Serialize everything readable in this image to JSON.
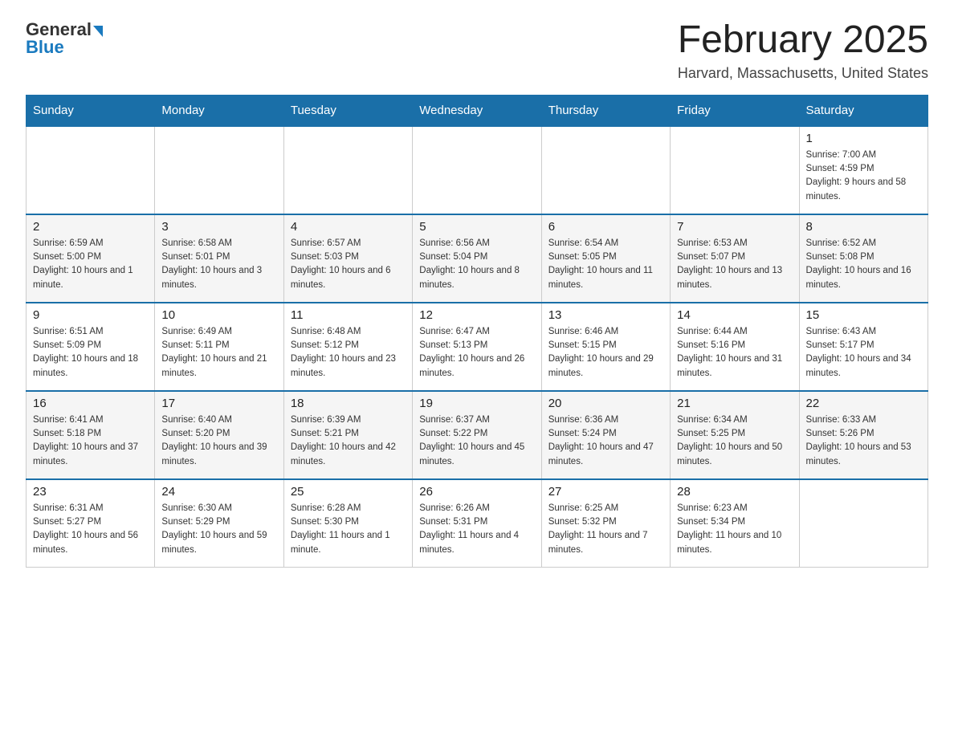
{
  "header": {
    "logo_general": "General",
    "logo_blue": "Blue",
    "month_title": "February 2025",
    "location": "Harvard, Massachusetts, United States"
  },
  "days_of_week": [
    "Sunday",
    "Monday",
    "Tuesday",
    "Wednesday",
    "Thursday",
    "Friday",
    "Saturday"
  ],
  "weeks": [
    [
      {
        "day": "",
        "info": ""
      },
      {
        "day": "",
        "info": ""
      },
      {
        "day": "",
        "info": ""
      },
      {
        "day": "",
        "info": ""
      },
      {
        "day": "",
        "info": ""
      },
      {
        "day": "",
        "info": ""
      },
      {
        "day": "1",
        "info": "Sunrise: 7:00 AM\nSunset: 4:59 PM\nDaylight: 9 hours and 58 minutes."
      }
    ],
    [
      {
        "day": "2",
        "info": "Sunrise: 6:59 AM\nSunset: 5:00 PM\nDaylight: 10 hours and 1 minute."
      },
      {
        "day": "3",
        "info": "Sunrise: 6:58 AM\nSunset: 5:01 PM\nDaylight: 10 hours and 3 minutes."
      },
      {
        "day": "4",
        "info": "Sunrise: 6:57 AM\nSunset: 5:03 PM\nDaylight: 10 hours and 6 minutes."
      },
      {
        "day": "5",
        "info": "Sunrise: 6:56 AM\nSunset: 5:04 PM\nDaylight: 10 hours and 8 minutes."
      },
      {
        "day": "6",
        "info": "Sunrise: 6:54 AM\nSunset: 5:05 PM\nDaylight: 10 hours and 11 minutes."
      },
      {
        "day": "7",
        "info": "Sunrise: 6:53 AM\nSunset: 5:07 PM\nDaylight: 10 hours and 13 minutes."
      },
      {
        "day": "8",
        "info": "Sunrise: 6:52 AM\nSunset: 5:08 PM\nDaylight: 10 hours and 16 minutes."
      }
    ],
    [
      {
        "day": "9",
        "info": "Sunrise: 6:51 AM\nSunset: 5:09 PM\nDaylight: 10 hours and 18 minutes."
      },
      {
        "day": "10",
        "info": "Sunrise: 6:49 AM\nSunset: 5:11 PM\nDaylight: 10 hours and 21 minutes."
      },
      {
        "day": "11",
        "info": "Sunrise: 6:48 AM\nSunset: 5:12 PM\nDaylight: 10 hours and 23 minutes."
      },
      {
        "day": "12",
        "info": "Sunrise: 6:47 AM\nSunset: 5:13 PM\nDaylight: 10 hours and 26 minutes."
      },
      {
        "day": "13",
        "info": "Sunrise: 6:46 AM\nSunset: 5:15 PM\nDaylight: 10 hours and 29 minutes."
      },
      {
        "day": "14",
        "info": "Sunrise: 6:44 AM\nSunset: 5:16 PM\nDaylight: 10 hours and 31 minutes."
      },
      {
        "day": "15",
        "info": "Sunrise: 6:43 AM\nSunset: 5:17 PM\nDaylight: 10 hours and 34 minutes."
      }
    ],
    [
      {
        "day": "16",
        "info": "Sunrise: 6:41 AM\nSunset: 5:18 PM\nDaylight: 10 hours and 37 minutes."
      },
      {
        "day": "17",
        "info": "Sunrise: 6:40 AM\nSunset: 5:20 PM\nDaylight: 10 hours and 39 minutes."
      },
      {
        "day": "18",
        "info": "Sunrise: 6:39 AM\nSunset: 5:21 PM\nDaylight: 10 hours and 42 minutes."
      },
      {
        "day": "19",
        "info": "Sunrise: 6:37 AM\nSunset: 5:22 PM\nDaylight: 10 hours and 45 minutes."
      },
      {
        "day": "20",
        "info": "Sunrise: 6:36 AM\nSunset: 5:24 PM\nDaylight: 10 hours and 47 minutes."
      },
      {
        "day": "21",
        "info": "Sunrise: 6:34 AM\nSunset: 5:25 PM\nDaylight: 10 hours and 50 minutes."
      },
      {
        "day": "22",
        "info": "Sunrise: 6:33 AM\nSunset: 5:26 PM\nDaylight: 10 hours and 53 minutes."
      }
    ],
    [
      {
        "day": "23",
        "info": "Sunrise: 6:31 AM\nSunset: 5:27 PM\nDaylight: 10 hours and 56 minutes."
      },
      {
        "day": "24",
        "info": "Sunrise: 6:30 AM\nSunset: 5:29 PM\nDaylight: 10 hours and 59 minutes."
      },
      {
        "day": "25",
        "info": "Sunrise: 6:28 AM\nSunset: 5:30 PM\nDaylight: 11 hours and 1 minute."
      },
      {
        "day": "26",
        "info": "Sunrise: 6:26 AM\nSunset: 5:31 PM\nDaylight: 11 hours and 4 minutes."
      },
      {
        "day": "27",
        "info": "Sunrise: 6:25 AM\nSunset: 5:32 PM\nDaylight: 11 hours and 7 minutes."
      },
      {
        "day": "28",
        "info": "Sunrise: 6:23 AM\nSunset: 5:34 PM\nDaylight: 11 hours and 10 minutes."
      },
      {
        "day": "",
        "info": ""
      }
    ]
  ]
}
